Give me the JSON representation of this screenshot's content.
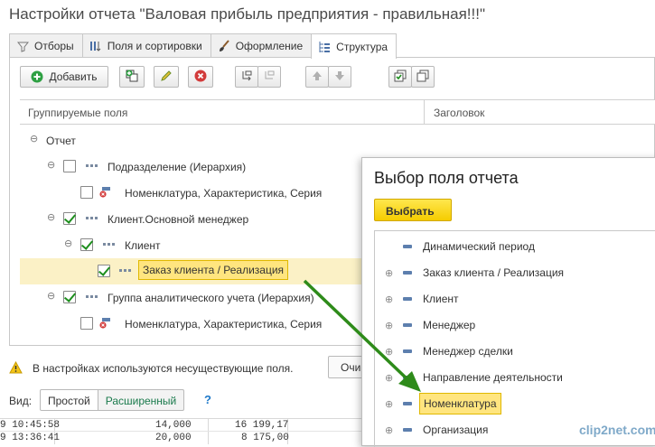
{
  "window": {
    "title": "Настройки отчета \"Валовая прибыль предприятия - правильная!!!\""
  },
  "tabs": [
    {
      "label": "Отборы",
      "icon": "filter-icon"
    },
    {
      "label": "Поля и сортировки",
      "icon": "fields-sort-icon"
    },
    {
      "label": "Оформление",
      "icon": "brush-icon"
    },
    {
      "label": "Структура",
      "icon": "structure-icon",
      "active": true
    }
  ],
  "toolbar": {
    "add_label": "Добавить",
    "icons": [
      "add-icon",
      "add-group-icon",
      "edit-icon",
      "delete-icon",
      "move-into-group-icon",
      "move-out-group-icon",
      "move-up-icon",
      "move-down-icon",
      "check-all-icon",
      "copy-icon"
    ]
  },
  "tree": {
    "columns": [
      "Группируемые поля",
      "Заголовок"
    ],
    "rows": [
      {
        "label": "Отчет",
        "checked": null
      },
      {
        "label": "Подразделение (Иерархия)",
        "checked": false
      },
      {
        "label": "Номенклатура, Характеристика, Серия",
        "checked": false
      },
      {
        "label": "Клиент.Основной менеджер",
        "checked": true
      },
      {
        "label": "Клиент",
        "checked": true
      },
      {
        "label": "Заказ клиента / Реализация",
        "checked": true
      },
      {
        "label": "Группа аналитического учета (Иерархия)",
        "checked": true
      },
      {
        "label": "Номенклатура, Характеристика, Серия",
        "checked": false
      }
    ]
  },
  "warning": {
    "text": "В настройках используются несуществующие поля.",
    "clean_button": "Очи"
  },
  "view": {
    "label": "Вид:",
    "simple": "Простой",
    "extended": "Расширенный",
    "help": "?"
  },
  "bottom_grid": [
    {
      "time": "9 10:45:58",
      "qty": "14,000",
      "amount": "16 199,17"
    },
    {
      "time": "9 13:36:41",
      "qty": "20,000",
      "amount": "8 175,00"
    }
  ],
  "popup": {
    "title": "Выбор поля отчета",
    "choose_label": "Выбрать",
    "items": [
      {
        "label": "Динамический период",
        "expandable": false
      },
      {
        "label": "Заказ клиента / Реализация",
        "expandable": true
      },
      {
        "label": "Клиент",
        "expandable": true
      },
      {
        "label": "Менеджер",
        "expandable": true
      },
      {
        "label": "Менеджер сделки",
        "expandable": true
      },
      {
        "label": "Направление деятельности",
        "expandable": true
      },
      {
        "label": "Номенклатура",
        "expandable": true,
        "highlighted": true
      },
      {
        "label": "Организация",
        "expandable": true
      }
    ]
  },
  "watermark": "clip2net.com",
  "colors": {
    "accent_yellow": "#ffe57f",
    "check_green": "#1e8f1e",
    "arrow_green": "#2e8b1a",
    "link_blue": "#1d78c8"
  }
}
